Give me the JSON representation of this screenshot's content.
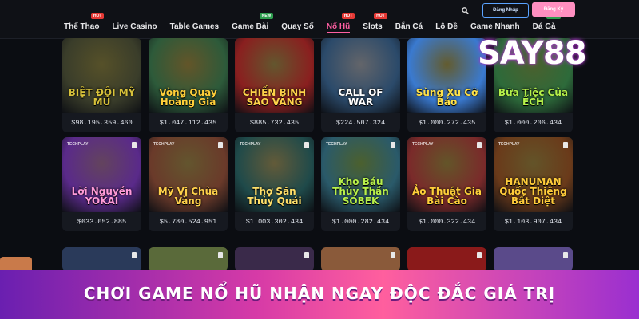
{
  "nav": {
    "items": [
      {
        "label": "Thể Thao",
        "badge": "HOT",
        "badge_type": "hot",
        "active": false
      },
      {
        "label": "Live Casino",
        "badge": "",
        "badge_type": "",
        "active": false
      },
      {
        "label": "Table Games",
        "badge": "",
        "badge_type": "",
        "active": false
      },
      {
        "label": "Game Bài",
        "badge": "NEW",
        "badge_type": "new",
        "active": false
      },
      {
        "label": "Quay Số",
        "badge": "",
        "badge_type": "",
        "active": false
      },
      {
        "label": "Nổ Hũ",
        "badge": "HOT",
        "badge_type": "hot",
        "active": true
      },
      {
        "label": "Slots",
        "badge": "HOT",
        "badge_type": "hot",
        "active": false
      },
      {
        "label": "Bắn Cá",
        "badge": "",
        "badge_type": "",
        "active": false
      },
      {
        "label": "Lô Đề",
        "badge": "",
        "badge_type": "",
        "active": false
      },
      {
        "label": "Game Nhanh",
        "badge": "",
        "badge_type": "",
        "active": false
      },
      {
        "label": "Đá Gà",
        "badge": "NEW",
        "badge_type": "new",
        "active": false
      }
    ]
  },
  "header": {
    "login_label": "Đăng Nhập",
    "register_label": "Đăng Ký"
  },
  "brand": {
    "logo_text": "SAY88"
  },
  "games": [
    {
      "title": "BIỆT ĐỘI MỸ MŨ",
      "jackpot": "$98.195.359.460",
      "color": "#3a3d2a",
      "accent": "#d8c23a",
      "provider": ""
    },
    {
      "title": "Vòng Quay Hoàng Gia",
      "jackpot": "$1.047.112.435",
      "color": "#2d5a3a",
      "accent": "#ffcf3a",
      "provider": ""
    },
    {
      "title": "CHIẾN BINH SAO VÀNG",
      "jackpot": "$885.732.435",
      "color": "#8a1f1f",
      "accent": "#ffd34a",
      "provider": ""
    },
    {
      "title": "CALL OF WAR",
      "jackpot": "$224.507.324",
      "color": "#2b4a6a",
      "accent": "#ffffff",
      "provider": ""
    },
    {
      "title": "Sùng Xu Cỡ Bảo",
      "jackpot": "$1.000.272.435",
      "color": "#3a7ad0",
      "accent": "#ffe24a",
      "provider": ""
    },
    {
      "title": "Bữa Tiệc Của ẾCH",
      "jackpot": "$1.000.206.434",
      "color": "#2d6a3a",
      "accent": "#b6f24a",
      "provider": ""
    },
    {
      "title": "Lời Nguyền YOKAI",
      "jackpot": "$633.052.885",
      "color": "#5a2a8a",
      "accent": "#ff9ad8",
      "provider": "TECHPLAY"
    },
    {
      "title": "Mỹ Vị Chùa Vàng",
      "jackpot": "$5.780.524.951",
      "color": "#6a3a2a",
      "accent": "#ffd04a",
      "provider": "TECHPLAY"
    },
    {
      "title": "Thợ Săn Thủy Quái",
      "jackpot": "$1.003.302.434",
      "color": "#1f4a4a",
      "accent": "#ffe06a",
      "provider": "TECHPLAY"
    },
    {
      "title": "Kho Báu Thủy Thần SOBEK",
      "jackpot": "$1.000.282.434",
      "color": "#2a5a6a",
      "accent": "#b8f04a",
      "provider": "TECHPLAY"
    },
    {
      "title": "Ảo Thuật Gia Bài Cào",
      "jackpot": "$1.000.322.434",
      "color": "#7a2a2a",
      "accent": "#ffcf3a",
      "provider": "TECHPLAY"
    },
    {
      "title": "HANUMAN Quốc Thiêng Bất Diệt",
      "jackpot": "$1.103.907.434",
      "color": "#6a3a1a",
      "accent": "#ffcc3a",
      "provider": "TECHPLAY"
    }
  ],
  "partial_row": [
    {
      "color": "#2a3a5a"
    },
    {
      "color": "#5a6a3a"
    },
    {
      "color": "#3a2a4a"
    },
    {
      "color": "#8a5a3a"
    },
    {
      "color": "#8a1a1a"
    },
    {
      "color": "#5a4a8a"
    }
  ],
  "banner": {
    "text": "CHƠI GAME NỔ HŨ NHẬN NGAY ĐỘC ĐẮC GIÁ TRỊ"
  }
}
